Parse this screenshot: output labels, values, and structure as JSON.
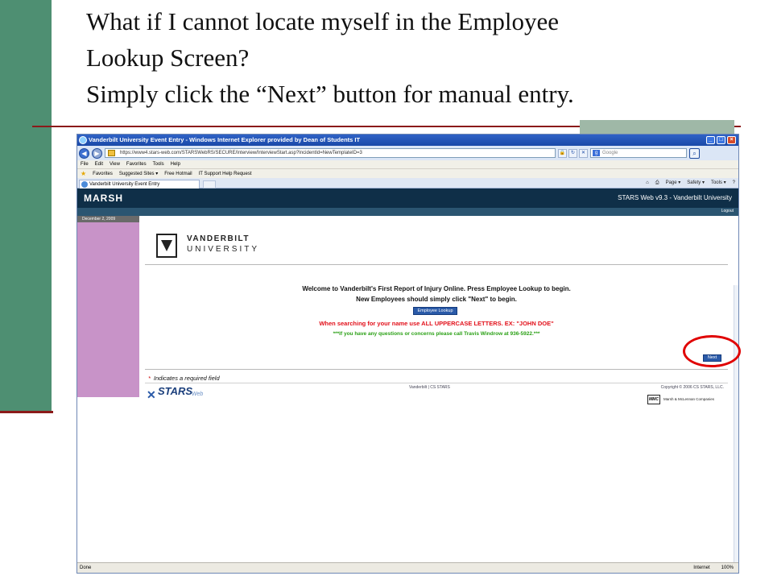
{
  "slide": {
    "title_lines": [
      "What if I cannot locate myself in the Employee",
      "Lookup Screen?",
      "Simply click the “Next” button for manual entry."
    ]
  },
  "browser": {
    "window_title": "Vanderbilt University Event Entry - Windows Internet Explorer provided by Dean of Students IT",
    "address_url": "https://www4.stars-web.com/STARSWebRS/SECURE/Interview/InterviewStart.asp?IncidentId=NewTemplateID=3",
    "search_placeholder": "Google",
    "menu": [
      "File",
      "Edit",
      "View",
      "Favorites",
      "Tools",
      "Help"
    ],
    "favorites_label": "Favorites",
    "favorites_links": [
      "Suggested Sites ▾",
      "Free Hotmail",
      "IT Support Help Request"
    ],
    "tab_label": "Vanderbilt University Event Entry",
    "command_bar": [
      "Page ▾",
      "Safety ▾",
      "Tools ▾"
    ],
    "status_left": "Done",
    "status_zone": "Internet",
    "status_zoom": "100%"
  },
  "page": {
    "brand": "MARSH",
    "product_version": "STARS Web v9.3 - Vanderbilt University",
    "logout": "Logout",
    "date": "December 2, 2009",
    "university_name": "VANDERBILT",
    "university_sub": "UNIVERSITY",
    "welcome_text": "Welcome to Vanderbilt's First Report of Injury Online. Press Employee Lookup to begin.",
    "new_employee_text": "New Employees should simply click \"Next\" to begin.",
    "lookup_button": "Employee Lookup",
    "uppercase_note": "When searching for your name use ALL UPPERCASE LETTERS. EX: \"JOHN DOE\"",
    "questions_note": "***If you have any questions or concerns please call Travis Windrow at 936-5922.***",
    "next_button": "Next",
    "required_marker": "*",
    "required_text": "Indicates a required field",
    "footer_links": "Vanderbilt | CS STARS",
    "copyright": "Copyright © 2006 CS STARS, LLC.",
    "stars_logo": "STARS",
    "stars_web": "Web",
    "mmc_logo": "MMC",
    "mmc_text": "Marsh & McLennan Companies"
  }
}
